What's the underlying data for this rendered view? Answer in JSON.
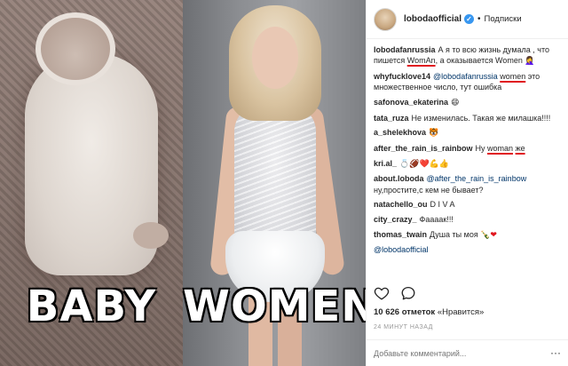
{
  "photo": {
    "left_caption": "BABY",
    "right_caption": "WOMEN"
  },
  "header": {
    "username": "lobodaofficial",
    "verified_glyph": "✓",
    "separator": "•",
    "follow_label": "Подписки"
  },
  "comments": [
    {
      "user": "lobodafanrussia",
      "parts": [
        {
          "t": "А я то всю жизнь думала , что пишется "
        },
        {
          "t": "WomAn",
          "ul": true
        },
        {
          "t": ", а оказывается Women "
        },
        {
          "t": "🤦‍♀️",
          "emoji": true
        }
      ]
    },
    {
      "user": "whyfucklove14",
      "parts": [
        {
          "t": "@lobodafanrussia",
          "mention": true
        },
        {
          "t": " "
        },
        {
          "t": "women",
          "ul": true
        },
        {
          "t": " это множественное число, тут ошибка"
        }
      ]
    },
    {
      "user": "safonova_ekaterina",
      "parts": [
        {
          "t": "😄",
          "emoji": true
        }
      ]
    },
    {
      "user": "tata_ruza",
      "parts": [
        {
          "t": "Не изменилась. Такая же милашка!!!!"
        }
      ]
    },
    {
      "user": "a_shelekhova",
      "parts": [
        {
          "t": "🐯",
          "emoji": true
        }
      ]
    },
    {
      "user": "after_the_rain_is_rainbow",
      "parts": [
        {
          "t": "Ну "
        },
        {
          "t": "woman",
          "ul": true
        },
        {
          "t": " "
        },
        {
          "t": "же",
          "ul": true
        }
      ]
    },
    {
      "user": "kri.al_",
      "parts": [
        {
          "t": "💍🏈❤️💪👍",
          "emoji": true
        }
      ]
    },
    {
      "user": "about.loboda",
      "parts": [
        {
          "t": "@after_the_rain_is_rainbow",
          "mention": true
        },
        {
          "t": " ну,простите,с кем не бывает?"
        }
      ]
    },
    {
      "user": "natachello_ou",
      "parts": [
        {
          "t": "D I V A"
        }
      ]
    },
    {
      "user": "city_crazy_",
      "parts": [
        {
          "t": "Фаааак!!!"
        }
      ]
    },
    {
      "user": "thomas_twain",
      "parts": [
        {
          "t": "Душа ты моя "
        },
        {
          "t": "🍾",
          "emoji": true
        },
        {
          "t": "❤",
          "heart": true
        }
      ]
    },
    {
      "user": "",
      "parts": [
        {
          "t": "@lobodaofficial",
          "mention": true
        }
      ]
    }
  ],
  "likes": {
    "count": "10 626 отметок",
    "suffix": " «Нравится»"
  },
  "timestamp": "24 МИНУТ НАЗАД",
  "add_comment": {
    "placeholder": "Добавьте комментарий..."
  },
  "more_label": "···",
  "colors": {
    "link": "#003569",
    "verified": "#3897f0",
    "underline": "#e0141e",
    "muted": "#999999"
  },
  "icons": [
    "heart-icon",
    "comment-icon"
  ]
}
